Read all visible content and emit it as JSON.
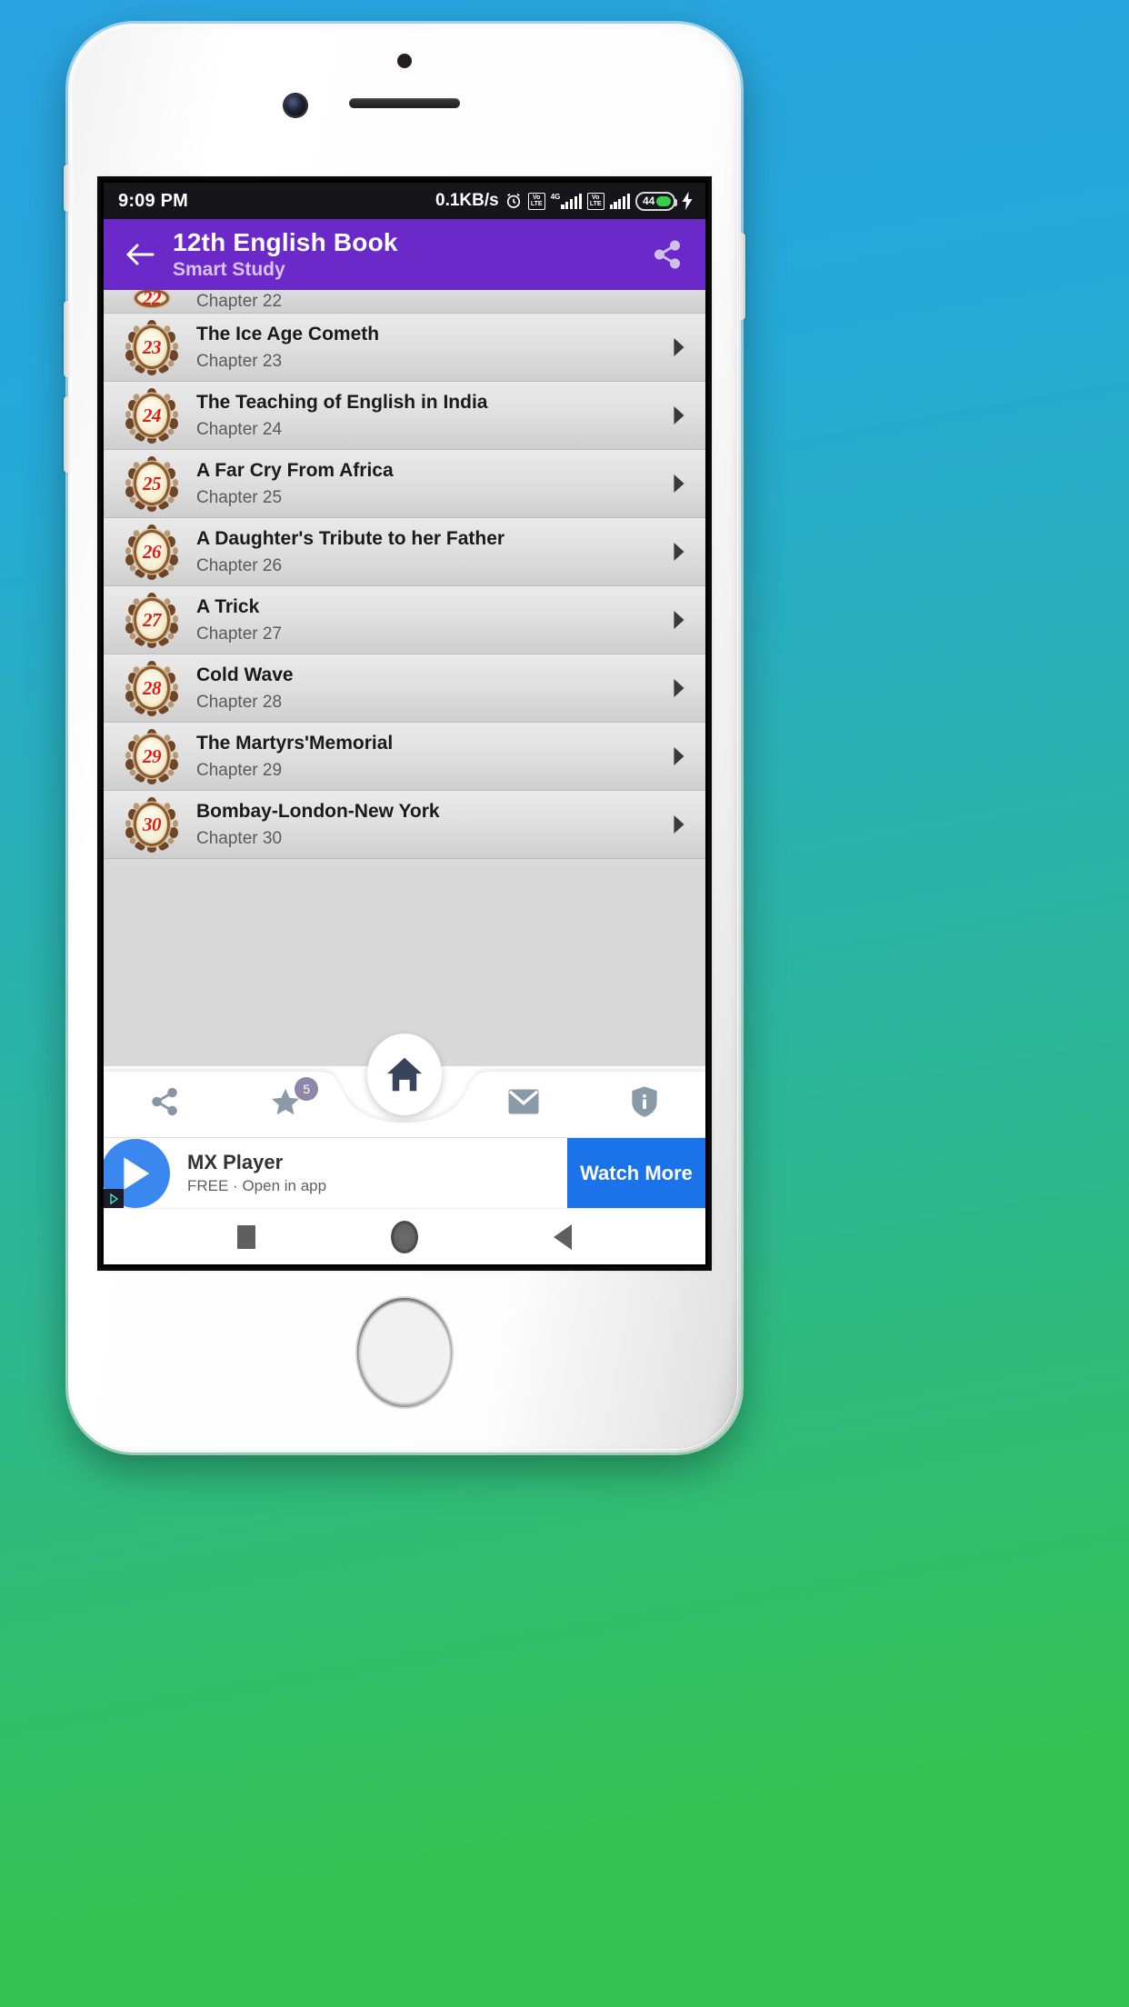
{
  "status_bar": {
    "time": "9:09 PM",
    "network_speed": "0.1KB/s",
    "alarm_icon": "alarm-clock-icon",
    "sim1_volte": "VoLTE",
    "sim1_network": "4G",
    "sim2_volte": "VoLTE",
    "battery_level": "44",
    "charging_icon": "lightning-bolt-icon"
  },
  "app_bar": {
    "back_icon": "arrow-left-icon",
    "title": "12th English Book",
    "subtitle": "Smart Study",
    "share_icon": "share-icon",
    "background_color": "#6c29c9"
  },
  "chapter_list": {
    "partial_top_row": {
      "number": "22",
      "subtitle": "Chapter 22"
    },
    "rows": [
      {
        "number": "23",
        "title": "The Ice Age Cometh",
        "subtitle": "Chapter 23"
      },
      {
        "number": "24",
        "title": "The Teaching of English in India",
        "subtitle": "Chapter 24"
      },
      {
        "number": "25",
        "title": "A Far Cry From Africa",
        "subtitle": "Chapter 25"
      },
      {
        "number": "26",
        "title": "A Daughter's Tribute to her Father",
        "subtitle": "Chapter 26"
      },
      {
        "number": "27",
        "title": "A Trick",
        "subtitle": "Chapter 27"
      },
      {
        "number": "28",
        "title": "Cold Wave",
        "subtitle": "Chapter 28"
      },
      {
        "number": "29",
        "title": "The Martyrs'Memorial",
        "subtitle": "Chapter 29"
      },
      {
        "number": "30",
        "title": "Bombay-London-New York",
        "subtitle": "Chapter 30"
      }
    ],
    "row_chevron_icon": "chevron-right-icon",
    "medallion_number_color": "#e41b12"
  },
  "bottom_nav": {
    "share_icon": "share-icon",
    "favorites_icon": "star-icon",
    "favorites_badge": "5",
    "home_icon": "home-icon",
    "mail_icon": "mail-icon",
    "info_icon": "shield-info-icon"
  },
  "ad_banner": {
    "play_icon": "play-triangle-icon",
    "adchoices_icon": "adchoices-icon",
    "title": "MX Player",
    "subtitle": "FREE · Open in app",
    "cta_label": "Watch More",
    "cta_color": "#1a73e8"
  },
  "android_nav": {
    "recents_icon": "square-recents-icon",
    "home_icon": "circle-home-icon",
    "back_icon": "triangle-back-icon"
  }
}
